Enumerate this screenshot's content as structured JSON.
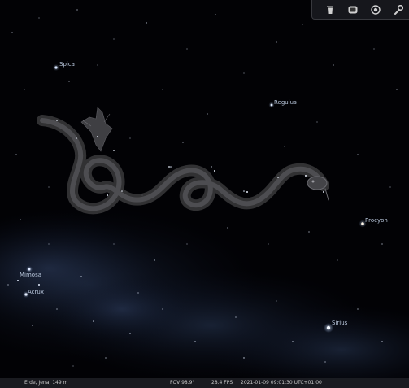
{
  "sky": {
    "stars": [
      {
        "name": "Spica"
      },
      {
        "name": "Regulus"
      },
      {
        "name": "Procyon"
      },
      {
        "name": "Mimosa"
      },
      {
        "name": "Acrux"
      },
      {
        "name": "Sirius"
      }
    ],
    "constellations": [
      "hydra-art",
      "corvus-art"
    ]
  },
  "toolbar": {
    "buttons": [
      "trash-icon",
      "screen-icon",
      "target-icon",
      "wrench-icon"
    ]
  },
  "status": {
    "location": "Erde, Jena, 149 m",
    "fov": "FOV 98.9°",
    "fps": "28.4 FPS",
    "datetime": "2021-01-09 09:01:30 UTC+01:00"
  },
  "colors": {
    "sky": "#020205",
    "milky_way": "#1c2a44",
    "label": "#b9c7dc"
  }
}
